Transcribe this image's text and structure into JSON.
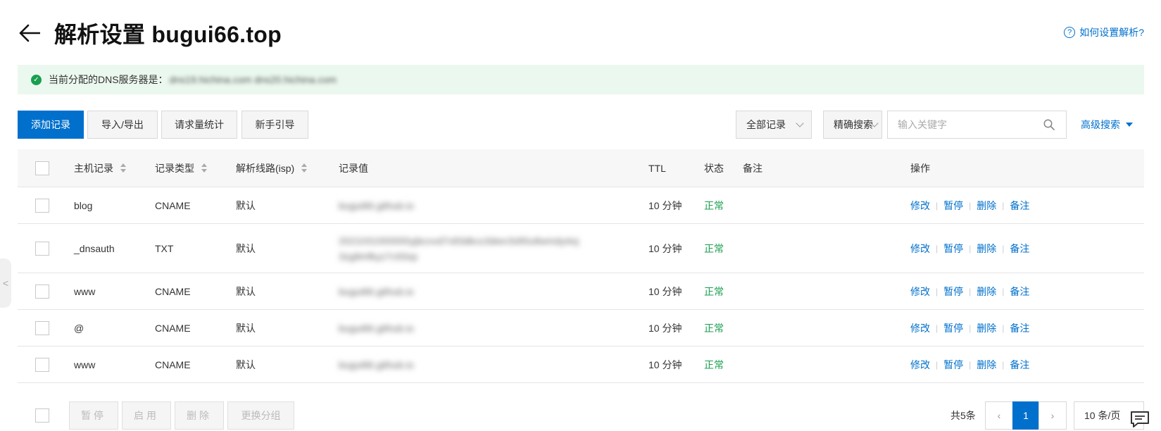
{
  "header": {
    "title": "解析设置 bugui66.top",
    "help_link": "如何设置解析?",
    "help_glyph": "?"
  },
  "notice": {
    "label": "当前分配的DNS服务器是：",
    "value": "dns19.hichina.com dns20.hichina.com",
    "check_glyph": "✓"
  },
  "toolbar": {
    "add_record": "添加记录",
    "import_export": "导入/导出",
    "request_stats": "请求量统计",
    "beginner_guide": "新手引导",
    "record_filter": "全部记录",
    "search_mode": "精确搜索",
    "search_placeholder": "输入关键字",
    "advanced_search": "高级搜索"
  },
  "table": {
    "columns": {
      "host": "主机记录",
      "type": "记录类型",
      "line": "解析线路(isp)",
      "value": "记录值",
      "ttl": "TTL",
      "status": "状态",
      "remark": "备注",
      "actions": "操作"
    },
    "rows": [
      {
        "host": "blog",
        "type": "CNAME",
        "line": "默认",
        "value": "bugui66.github.io",
        "value2": "",
        "ttl": "10 分钟",
        "status": "正常"
      },
      {
        "host": "_dnsauth",
        "type": "TXT",
        "line": "默认",
        "value": "2021031000000yjbcxvd7x83dkco3dwv3sfi0u8wmdy4oj",
        "value2": "3zg8mfkyz7c93xp",
        "ttl": "10 分钟",
        "status": "正常"
      },
      {
        "host": "www",
        "type": "CNAME",
        "line": "默认",
        "value": "bugui66.github.io",
        "value2": "",
        "ttl": "10 分钟",
        "status": "正常"
      },
      {
        "host": "@",
        "type": "CNAME",
        "line": "默认",
        "value": "bugui66.github.io",
        "value2": "",
        "ttl": "10 分钟",
        "status": "正常"
      },
      {
        "host": "www",
        "type": "CNAME",
        "line": "默认",
        "value": "bugui66.github.io",
        "value2": "",
        "ttl": "10 分钟",
        "status": "正常"
      }
    ],
    "actions": {
      "edit": "修改",
      "pause": "暂停",
      "delete": "删除",
      "remark": "备注",
      "separator": "|"
    }
  },
  "footer": {
    "pause": "暂停",
    "enable": "启用",
    "delete": "删除",
    "change_group": "更换分组",
    "total": "共5条",
    "prev": "‹",
    "current_page": "1",
    "next": "›",
    "page_size": "10 条/页"
  },
  "side_handle_glyph": "<",
  "colors": {
    "accent": "#0070cc",
    "success": "#1a9e4f",
    "notice_bg": "#ebf8ef"
  }
}
